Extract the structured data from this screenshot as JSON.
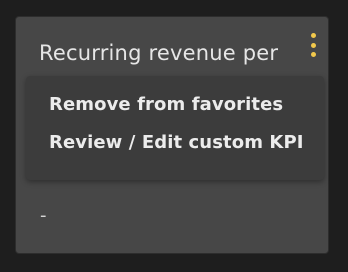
{
  "card": {
    "title": "Recurring revenue per",
    "value": "-",
    "menu_icon": "vertical-ellipsis-icon",
    "accent_color": "#f2c94c"
  },
  "menu": {
    "items": [
      {
        "label": "Remove from favorites"
      },
      {
        "label": "Review / Edit custom KPI"
      }
    ]
  }
}
